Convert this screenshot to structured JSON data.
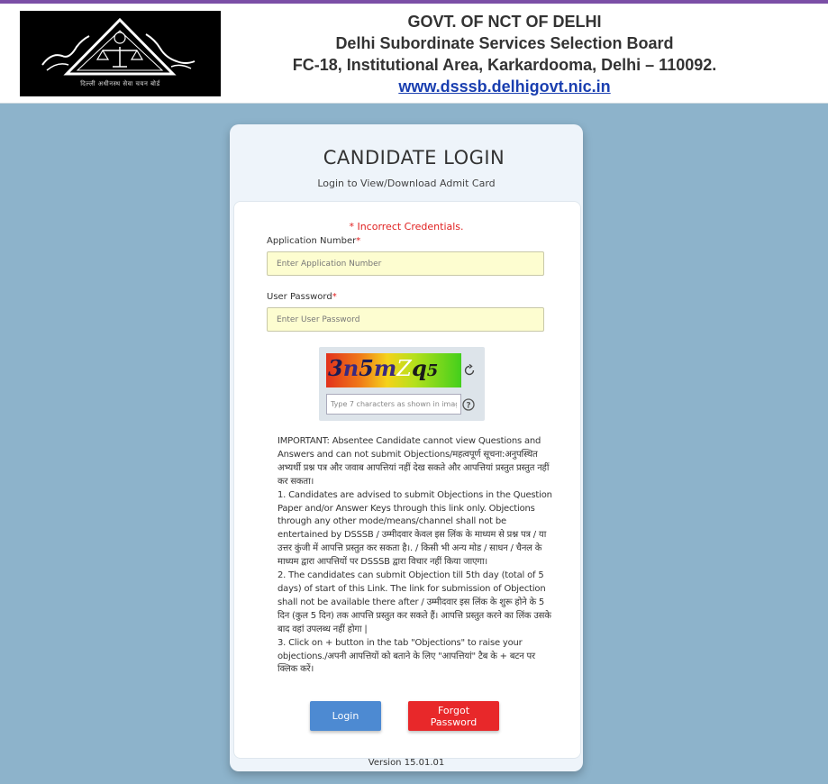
{
  "header": {
    "logo_caption": "दिल्ली अधीनस्थ सेवा चयन बोर्ड",
    "line1": "GOVT. OF NCT OF DELHI",
    "line2": "Delhi Subordinate Services Selection Board",
    "line3": "FC-18, Institutional Area, Karkardooma, Delhi – 110092.",
    "url": "www.dsssb.delhigovt.nic.in"
  },
  "login": {
    "title": "CANDIDATE LOGIN",
    "subtitle": "Login to View/Download Admit Card",
    "error": "* Incorrect Credentials.",
    "app_number_label": "Application Number",
    "app_number_placeholder": "Enter Application Number",
    "app_number_value": "",
    "password_label": "User Password",
    "password_placeholder": "Enter User Password",
    "password_value": "",
    "required_mark": "*"
  },
  "captcha": {
    "chars": [
      "3",
      "n",
      "5",
      "m",
      "Z",
      "q",
      "5"
    ],
    "input_placeholder": "Type 7 characters as shown in image",
    "input_value": ""
  },
  "notice": {
    "lines": [
      "IMPORTANT: Absentee Candidate cannot view Questions and Answers and can not submit Objections/महत्वपूर्ण सूचना:अनुपस्थित अभ्यर्थी प्रश्न पत्र और जवाब आपत्तियां नहीं देख सकते और आपत्तियां प्रस्तुत प्रस्तुत नहीं कर सकता।",
      "1. Candidates are advised to submit Objections in the Question Paper and/or Answer Keys through this link only. Objections through any other mode/means/channel shall not be entertained by DSSSB / उम्मीदवार केवल इस लिंक के माध्यम से प्रश्न पत्र / या उत्तर कुंजी में आपत्ति प्रस्तुत कर सकता है।. / किसी भी अन्य मोड / साधन / चैनल के माध्यम द्वारा आपत्तियों पर DSSSB द्वारा विचार नहीं किया जाएगा।",
      "2. The candidates can submit Objection till 5th day (total of 5 days) of start of this Link. The link for submission of Objection shall not be available there after / उम्मीदवार इस लिंक के शुरू होने के 5 दिन (कुल 5 दिन) तक आपत्ति प्रस्तुत कर सकते हैं। आपत्ति प्रस्तुत करने का लिंक उसके बाद वहां उपलब्ध नहीं होगा |",
      "3. Click on + button in the tab \"Objections\" to raise your objections./अपनी आपत्तियों को बताने के लिए \"आपत्तियां\" टैब के + बटन पर क्लिक करें।"
    ]
  },
  "buttons": {
    "login": "Login",
    "forgot": "Forgot Password"
  },
  "footer": {
    "version": "Version 15.01.01"
  },
  "colors": {
    "background": "#8db3cb",
    "top_bar": "#7b4fa6",
    "login_button": "#4d8ad2",
    "forgot_button": "#e8282a",
    "error_text": "#e02020",
    "input_fill": "#fdfdd0",
    "link": "#1a3fb0"
  }
}
